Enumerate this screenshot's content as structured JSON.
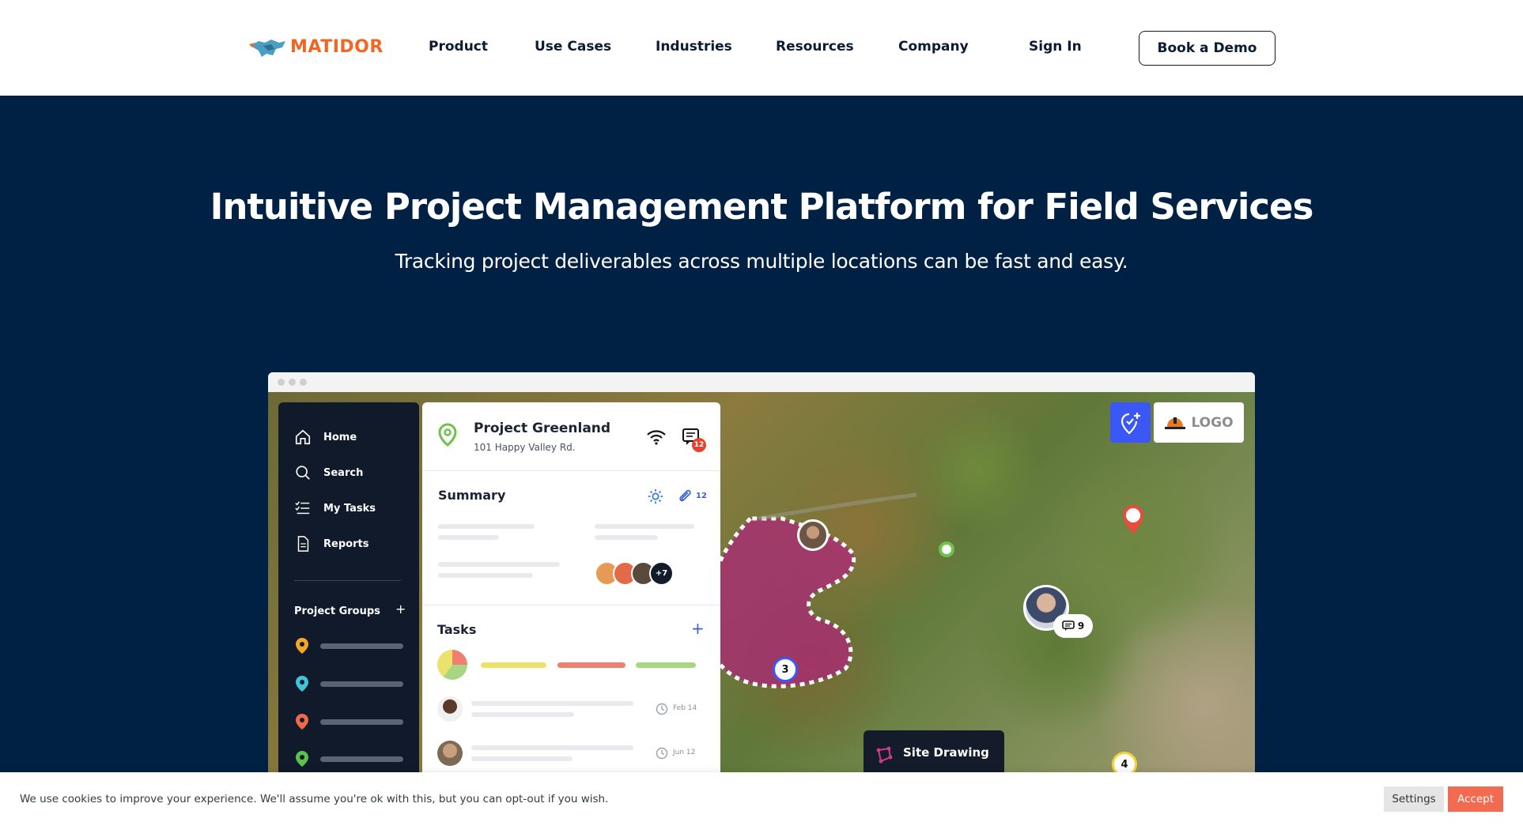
{
  "brand": {
    "name": "MATIDOR",
    "accent": "#f26522",
    "navy": "#012144"
  },
  "nav": {
    "items": [
      "Product",
      "Use Cases",
      "Industries",
      "Resources",
      "Company",
      "Sign In"
    ],
    "cta": "Book a Demo"
  },
  "hero": {
    "title": "Intuitive Project Management Platform for Field Services",
    "subtitle": "Tracking project deliverables across multiple locations can be fast and easy."
  },
  "app": {
    "sidebar": {
      "items": [
        {
          "label": "Home",
          "icon": "home-icon"
        },
        {
          "label": "Search",
          "icon": "search-icon"
        },
        {
          "label": "My Tasks",
          "icon": "tasks-icon"
        },
        {
          "label": "Reports",
          "icon": "document-icon"
        }
      ],
      "groups_label": "Project Groups",
      "group_pin_colors": [
        "#f5a623",
        "#3ec6d6",
        "#f06a4a",
        "#5cc04a"
      ]
    },
    "project": {
      "title": "Project Greenland",
      "address": "101 Happy Valley Rd.",
      "message_count": "12",
      "summary_label": "Summary",
      "attachment_count": "12",
      "extra_members": "+7",
      "tasks_label": "Tasks",
      "tasks": [
        {
          "date": "Feb 14"
        },
        {
          "date": "Jun 12"
        }
      ]
    },
    "map": {
      "logo_label": "LOGO",
      "chat_count": "9",
      "markers": [
        "3",
        "4"
      ],
      "site_drawing_label": "Site Drawing"
    }
  },
  "cookie": {
    "text": "We use cookies to improve your experience. We'll assume you're ok with this, but you can opt-out if you wish.",
    "settings": "Settings",
    "accept": "Accept"
  }
}
